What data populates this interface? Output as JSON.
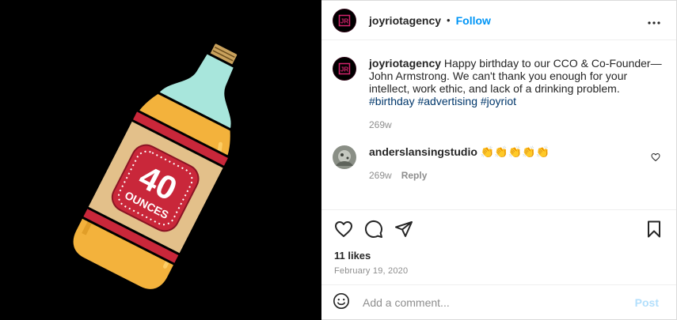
{
  "post": {
    "image": {
      "label_number": "40",
      "label_word": "OUNCES"
    },
    "header": {
      "username": "joyriotagency",
      "separator": "•",
      "follow_label": "Follow",
      "avatar_text": "JR"
    },
    "caption": {
      "username": "joyriotagency",
      "text": "Happy birthday to our CCO & Co-Founder—John Armstrong. We can't thank you enough for your intellect, work ethic, and lack of a drinking problem.",
      "hashtags": [
        "#birthday",
        "#advertising",
        "#joyriot"
      ],
      "age": "269w"
    },
    "comment": {
      "username": "anderslansingstudio",
      "text": "👏👏👏👏👏",
      "age": "269w",
      "reply_label": "Reply"
    },
    "stats": {
      "likes": "11 likes",
      "date": "February 19, 2020"
    },
    "add_comment": {
      "placeholder": "Add a comment...",
      "post_label": "Post"
    }
  },
  "colors": {
    "link_blue": "#0095f6",
    "hashtag_blue": "#00376b",
    "post_disabled": "#b2dffc",
    "bottle_body": "#f3b23c",
    "bottle_neck": "#a8e6dc",
    "label_red": "#c9273a"
  },
  "icons": [
    "more-options-icon",
    "heart-icon",
    "comment-icon",
    "share-icon",
    "save-icon",
    "emoji-icon"
  ]
}
